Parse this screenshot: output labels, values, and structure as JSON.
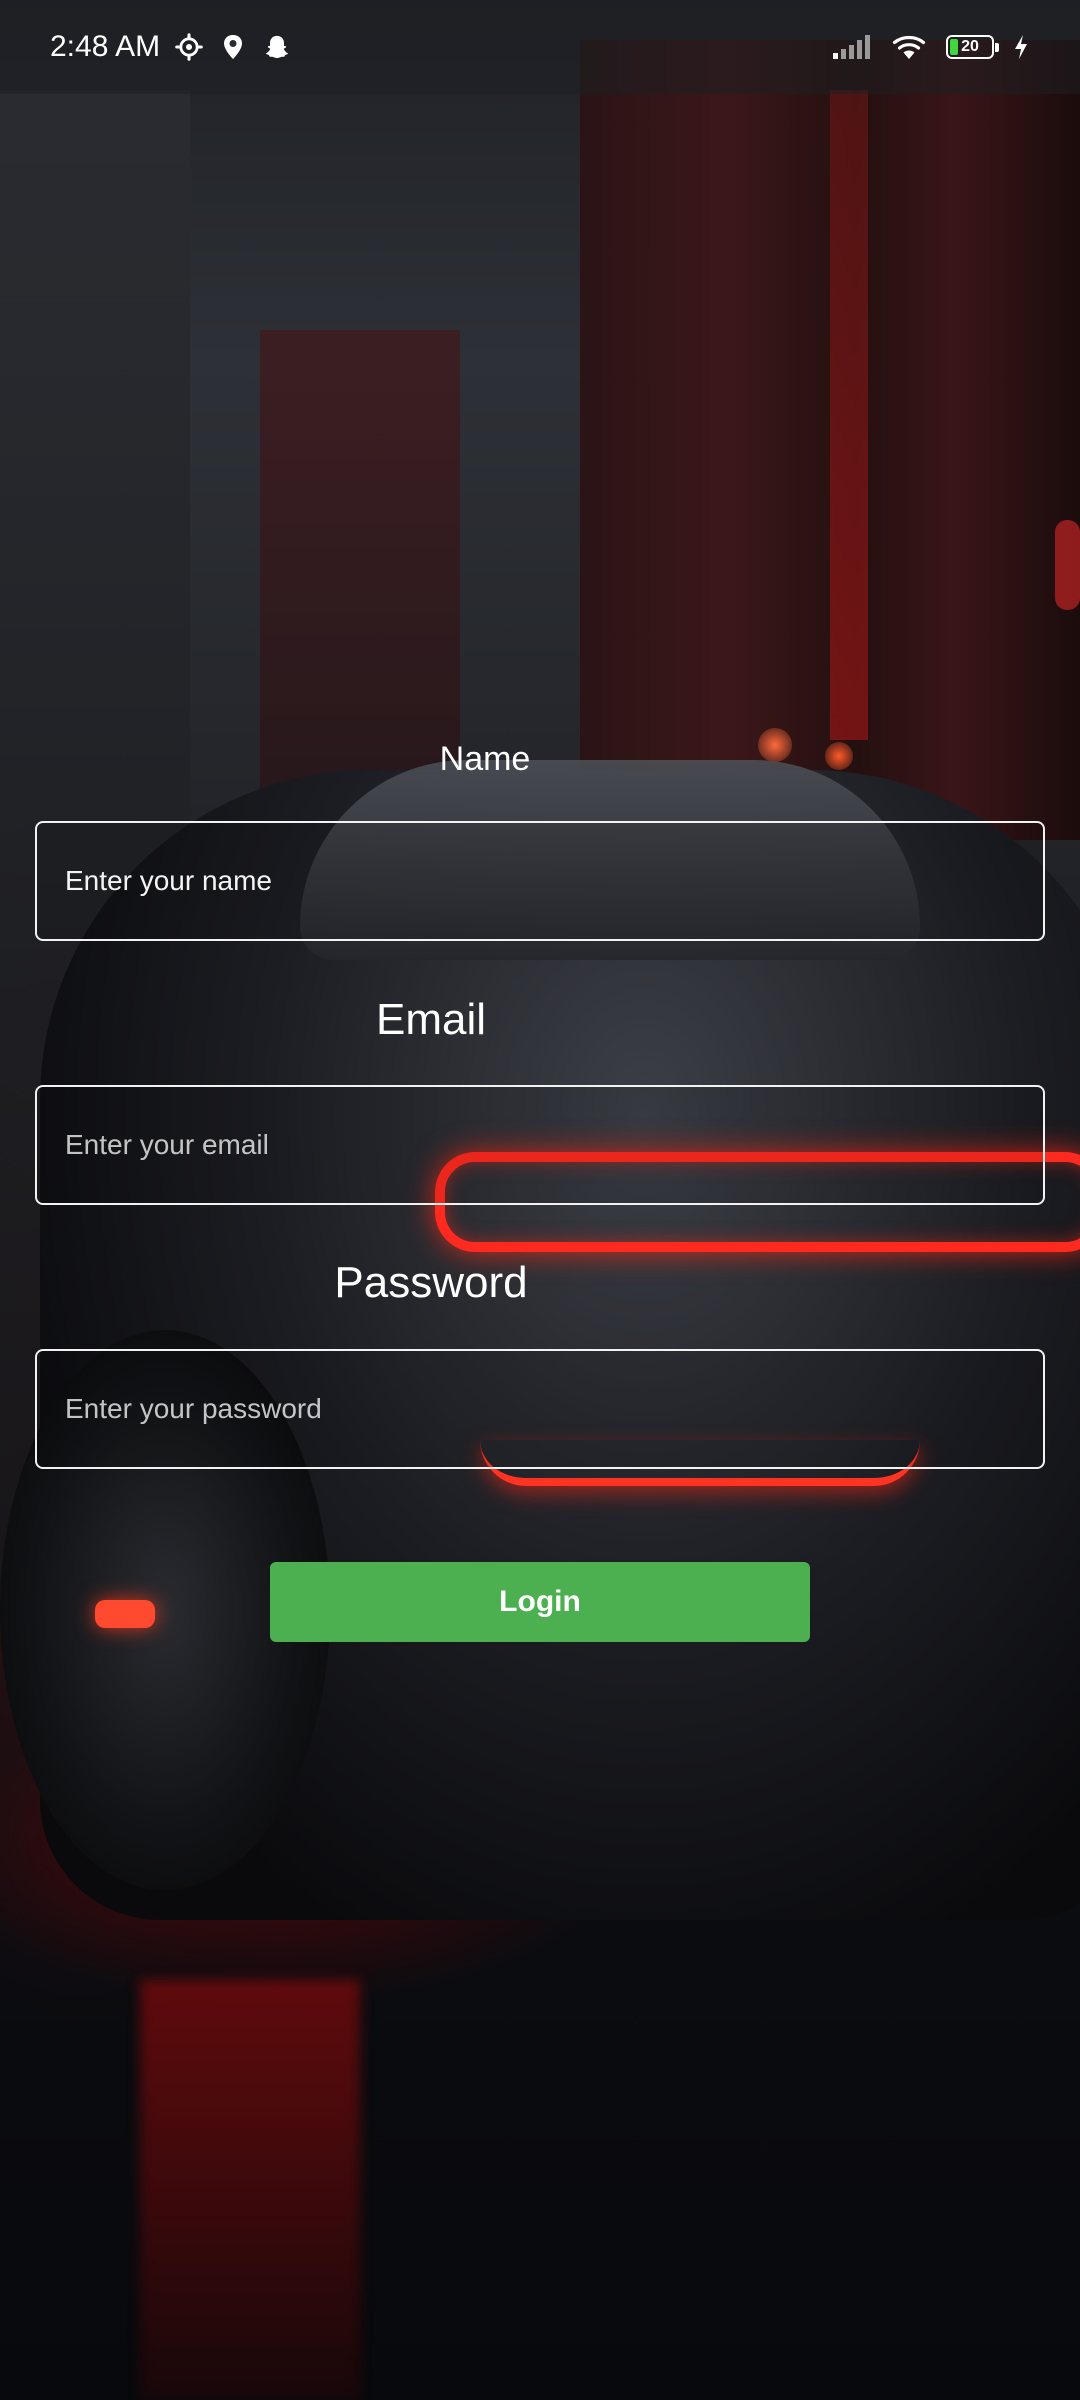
{
  "status_bar": {
    "time": "2:48 AM",
    "battery_level": "20",
    "battery_fraction": 0.2,
    "icons": [
      "settings-gear-icon",
      "location-pin-icon",
      "snapchat-ghost-icon",
      "cell-signal-icon",
      "wifi-icon",
      "battery-icon",
      "charging-bolt-icon"
    ]
  },
  "form": {
    "name": {
      "label": "Name",
      "placeholder": "Enter your name",
      "value": ""
    },
    "email": {
      "label": "Email",
      "placeholder": "Enter your email",
      "value": ""
    },
    "password": {
      "label": "Password",
      "placeholder": "Enter your password",
      "value": ""
    },
    "submit_label": "Login"
  },
  "colors": {
    "button_background": "#4caf50",
    "field_border": "#f2f2f2",
    "text": "#ffffff",
    "accent_red": "#ff2a1f"
  }
}
